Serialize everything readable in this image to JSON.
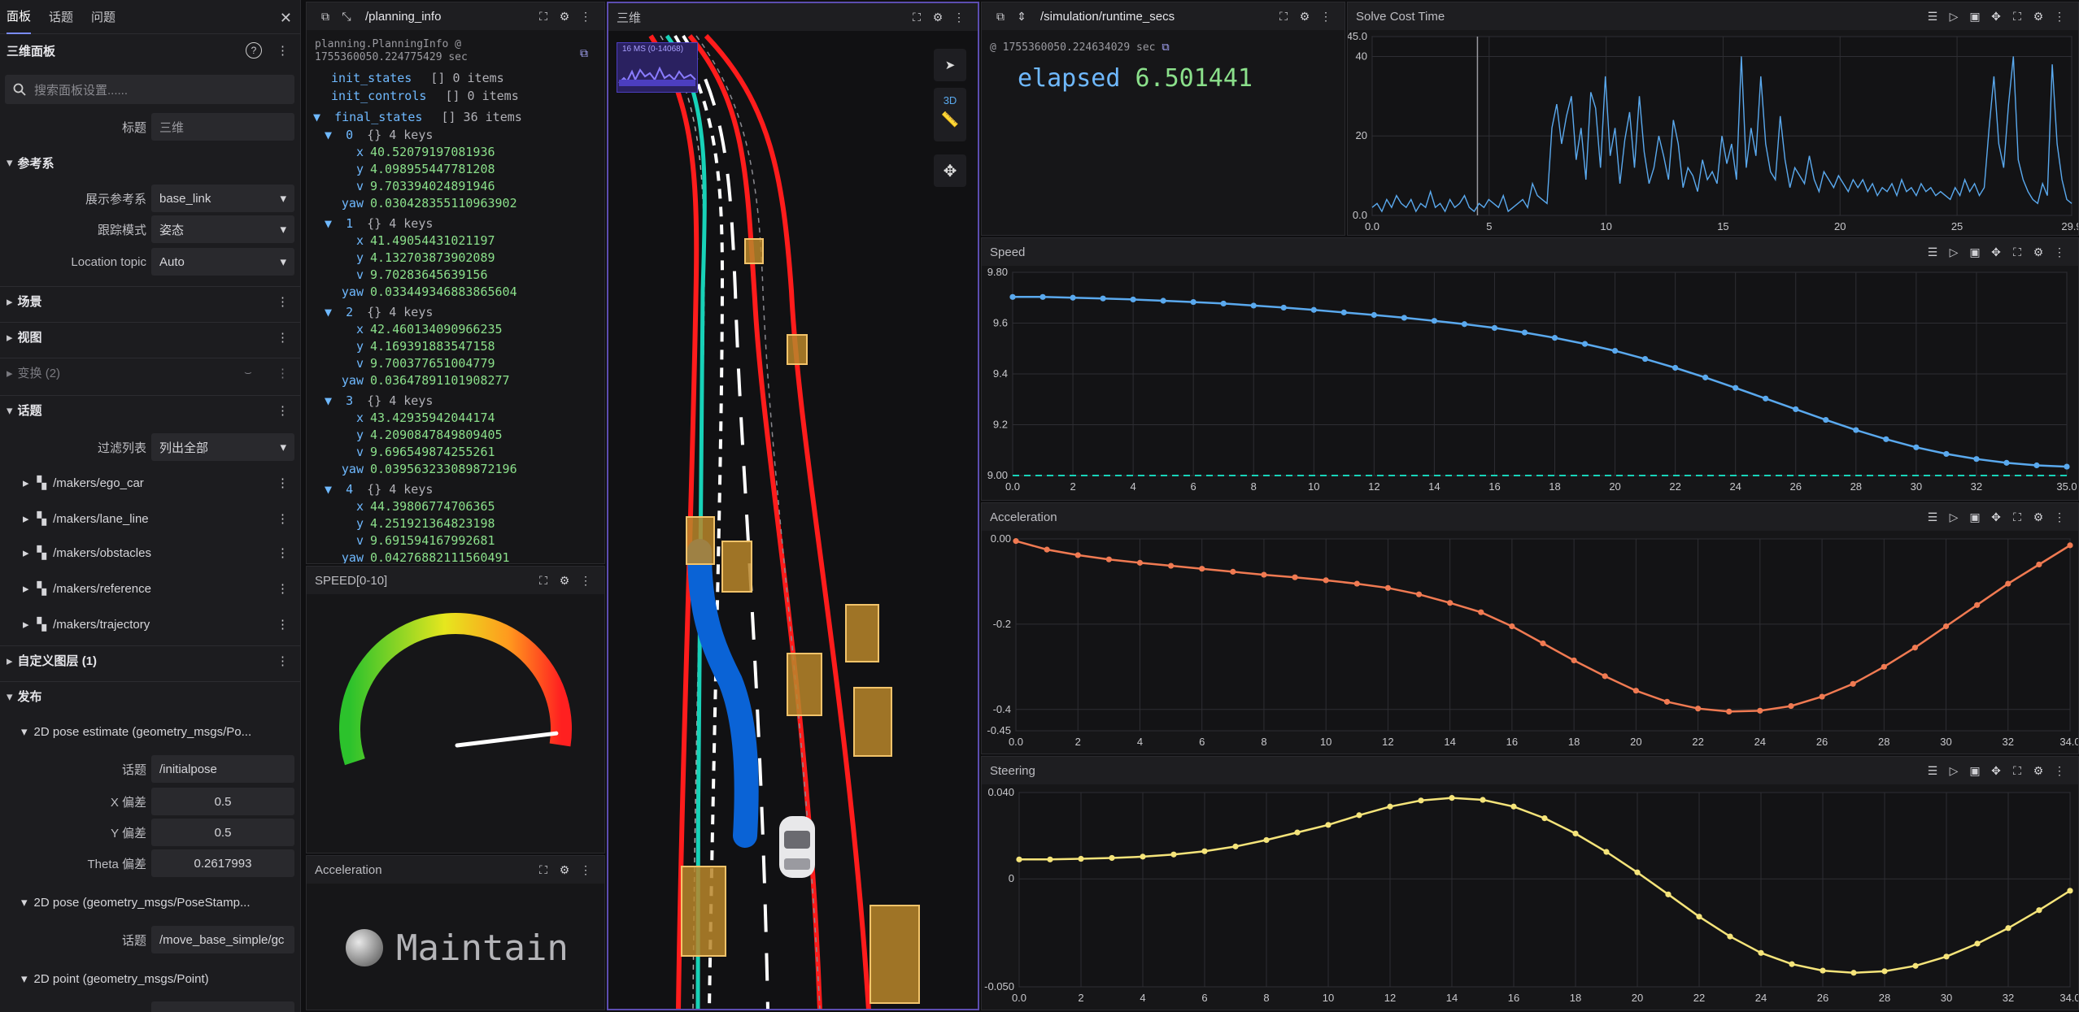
{
  "sidebar": {
    "tabs": [
      "面板",
      "话题",
      "问题"
    ],
    "panel_title": "三维面板",
    "search_placeholder": "搜索面板设置......",
    "title_label": "标题",
    "title_value": "三维",
    "frame_section": "参考系",
    "display_frame_label": "展示参考系",
    "display_frame_value": "base_link",
    "follow_mode_label": "跟踪模式",
    "follow_mode_value": "姿态",
    "location_topic_label": "Location topic",
    "location_topic_value": "Auto",
    "scene_section": "场景",
    "view_section": "视图",
    "transforms_section": "变换 (2)",
    "topics_section": "话题",
    "filter_label": "过滤列表",
    "filter_value": "列出全部",
    "topics": [
      "/makers/ego_car",
      "/makers/lane_line",
      "/makers/obstacles",
      "/makers/reference",
      "/makers/trajectory"
    ],
    "custom_layers": "自定义图层 (1)",
    "publish_section": "发布",
    "pose_estimate": "2D pose estimate (geometry_msgs/Po...",
    "topic_label": "话题",
    "pose_estimate_topic": "/initialpose",
    "x_dev_label": "X 偏差",
    "x_dev": "0.5",
    "y_dev_label": "Y 偏差",
    "y_dev": "0.5",
    "theta_label": "Theta 偏差",
    "theta_dev": "0.2617993",
    "pose": "2D pose (geometry_msgs/PoseStamp...",
    "pose_topic": "/move_base_simple/gc",
    "point": "2D point (geometry_msgs/Point)"
  },
  "planning": {
    "title": "/planning_info",
    "header": "planning.PlanningInfo @ 1755360050.224775429 sec",
    "init_states": "init_states",
    "init_controls": "init_controls",
    "empty_items": "[] 0 items",
    "final_states": "final_states",
    "final_count": "[] 36 items",
    "keys_label": "{} 4 keys",
    "states": [
      {
        "idx": "0",
        "x": "40.52079197081936",
        "y": "4.098955447781208",
        "v": "9.703394024891946",
        "yaw": "0.030428355110963902"
      },
      {
        "idx": "1",
        "x": "41.49054431021197",
        "y": "4.132703873902089",
        "v": "9.70283645639156",
        "yaw": "0.033449346883865604"
      },
      {
        "idx": "2",
        "x": "42.460134090966235",
        "y": "4.169391883547158",
        "v": "9.700377651004779",
        "yaw": "0.03647891101908277"
      },
      {
        "idx": "3",
        "x": "43.42935942044174",
        "y": "4.2090847849809405",
        "v": "9.696549874255261",
        "yaw": "0.039563233089872196"
      },
      {
        "idx": "4",
        "x": "44.39806774706365",
        "y": "4.251921364823198",
        "v": "9.691594167992681",
        "yaw": "0.04276882111560491"
      }
    ]
  },
  "speed_gauge": {
    "title": "SPEED[0-10]",
    "value": 9.7,
    "min": 0,
    "max": 10
  },
  "accel_indicator": {
    "title": "Acceleration",
    "status": "Maintain"
  },
  "view3d": {
    "title": "三维",
    "perf_label": "16 MS (0-14068)",
    "mode_3d": "3D"
  },
  "runtime": {
    "title": "/simulation/runtime_secs",
    "stamp": "@ 1755360050.224634029 sec",
    "label": "elapsed",
    "value": "6.501441"
  },
  "colors": {
    "accent": "#5aa9ee",
    "green": "#8be08b",
    "orange": "#f07a52",
    "yellow": "#f5e47a",
    "road": "#ff1a1a",
    "teal": "#18d2b8"
  },
  "chart_data": [
    {
      "type": "line",
      "title": "Solve Cost Time",
      "xlim": [
        0,
        29.9
      ],
      "ylim": [
        0,
        45
      ],
      "xticks": [
        "0.0",
        "5",
        "10",
        "15",
        "20",
        "25",
        "29.9"
      ],
      "yticks": [
        "45.0",
        "40",
        "20",
        "0.0"
      ],
      "series": [
        {
          "values": [
            2,
            3,
            1,
            4,
            2,
            5,
            3,
            2,
            4,
            1,
            3,
            2,
            6,
            2,
            3,
            1,
            4,
            2,
            3,
            5,
            2,
            1,
            3,
            2,
            4,
            3,
            2,
            5,
            1,
            2,
            3,
            4,
            2,
            8,
            5,
            4,
            3,
            22,
            28,
            18,
            25,
            30,
            14,
            22,
            9,
            31,
            27,
            12,
            35,
            15,
            22,
            8,
            19,
            26,
            12,
            30,
            16,
            8,
            12,
            20,
            15,
            9,
            24,
            18,
            7,
            12,
            10,
            6,
            14,
            9,
            11,
            8,
            20,
            13,
            18,
            9,
            40,
            12,
            22,
            15,
            35,
            18,
            11,
            9,
            25,
            14,
            7,
            12,
            10,
            8,
            15,
            9,
            6,
            11,
            9,
            7,
            10,
            8,
            6,
            9,
            7,
            9,
            6,
            8,
            5,
            7,
            6,
            8,
            5,
            9,
            6,
            7,
            5,
            8,
            6,
            7,
            5,
            6,
            5,
            4,
            7,
            5,
            9,
            6,
            8,
            5,
            7,
            22,
            35,
            18,
            12,
            28,
            40,
            14,
            9,
            6,
            4,
            3,
            8,
            5,
            38,
            18,
            9,
            4,
            3
          ]
        }
      ]
    },
    {
      "type": "line",
      "title": "Speed",
      "xlim": [
        0,
        35
      ],
      "ylim": [
        9.0,
        9.8
      ],
      "xticks": [
        "0.0",
        "2",
        "4",
        "6",
        "8",
        "10",
        "12",
        "14",
        "16",
        "18",
        "20",
        "22",
        "24",
        "26",
        "28",
        "30",
        "32",
        "35.0"
      ],
      "yticks": [
        "9.80",
        "9.6",
        "9.4",
        "9.2",
        "9.00"
      ],
      "series": [
        {
          "values": [
            9.703,
            9.703,
            9.7,
            9.697,
            9.693,
            9.688,
            9.683,
            9.677,
            9.669,
            9.661,
            9.652,
            9.642,
            9.632,
            9.621,
            9.609,
            9.596,
            9.581,
            9.563,
            9.542,
            9.518,
            9.491,
            9.459,
            9.424,
            9.386,
            9.345,
            9.303,
            9.261,
            9.219,
            9.179,
            9.143,
            9.111,
            9.085,
            9.065,
            9.05,
            9.04,
            9.035
          ]
        }
      ]
    },
    {
      "type": "line",
      "title": "Acceleration",
      "xlim": [
        0,
        34
      ],
      "ylim": [
        -0.45,
        0
      ],
      "xticks": [
        "0.0",
        "2",
        "4",
        "6",
        "8",
        "10",
        "12",
        "14",
        "16",
        "18",
        "20",
        "22",
        "24",
        "26",
        "28",
        "30",
        "32",
        "34.0"
      ],
      "yticks": [
        "0.00",
        "-0.2",
        "-0.4",
        "-0.45"
      ],
      "series": [
        {
          "values": [
            -0.005,
            -0.025,
            -0.038,
            -0.048,
            -0.056,
            -0.063,
            -0.07,
            -0.077,
            -0.084,
            -0.09,
            -0.097,
            -0.105,
            -0.115,
            -0.13,
            -0.15,
            -0.172,
            -0.205,
            -0.245,
            -0.285,
            -0.322,
            -0.356,
            -0.382,
            -0.398,
            -0.405,
            -0.403,
            -0.392,
            -0.37,
            -0.34,
            -0.3,
            -0.255,
            -0.205,
            -0.155,
            -0.105,
            -0.06,
            -0.015
          ]
        }
      ]
    },
    {
      "type": "line",
      "title": "Steering",
      "xlim": [
        0,
        34
      ],
      "ylim": [
        -0.05,
        0.04
      ],
      "xticks": [
        "0.0",
        "2",
        "4",
        "6",
        "8",
        "10",
        "12",
        "14",
        "16",
        "18",
        "20",
        "22",
        "24",
        "26",
        "28",
        "30",
        "32",
        "34.0"
      ],
      "yticks": [
        "0.040",
        "0",
        "-0.050"
      ],
      "series": [
        {
          "values": [
            0.009,
            0.009,
            0.0093,
            0.0097,
            0.0103,
            0.0113,
            0.0128,
            0.015,
            0.018,
            0.0215,
            0.025,
            0.0295,
            0.0335,
            0.0363,
            0.0375,
            0.0366,
            0.0335,
            0.0281,
            0.021,
            0.0125,
            0.003,
            -0.0072,
            -0.0175,
            -0.0267,
            -0.0343,
            -0.0395,
            -0.0425,
            -0.0435,
            -0.0428,
            -0.0403,
            -0.036,
            -0.03,
            -0.0228,
            -0.0145,
            -0.0055
          ]
        }
      ]
    }
  ]
}
